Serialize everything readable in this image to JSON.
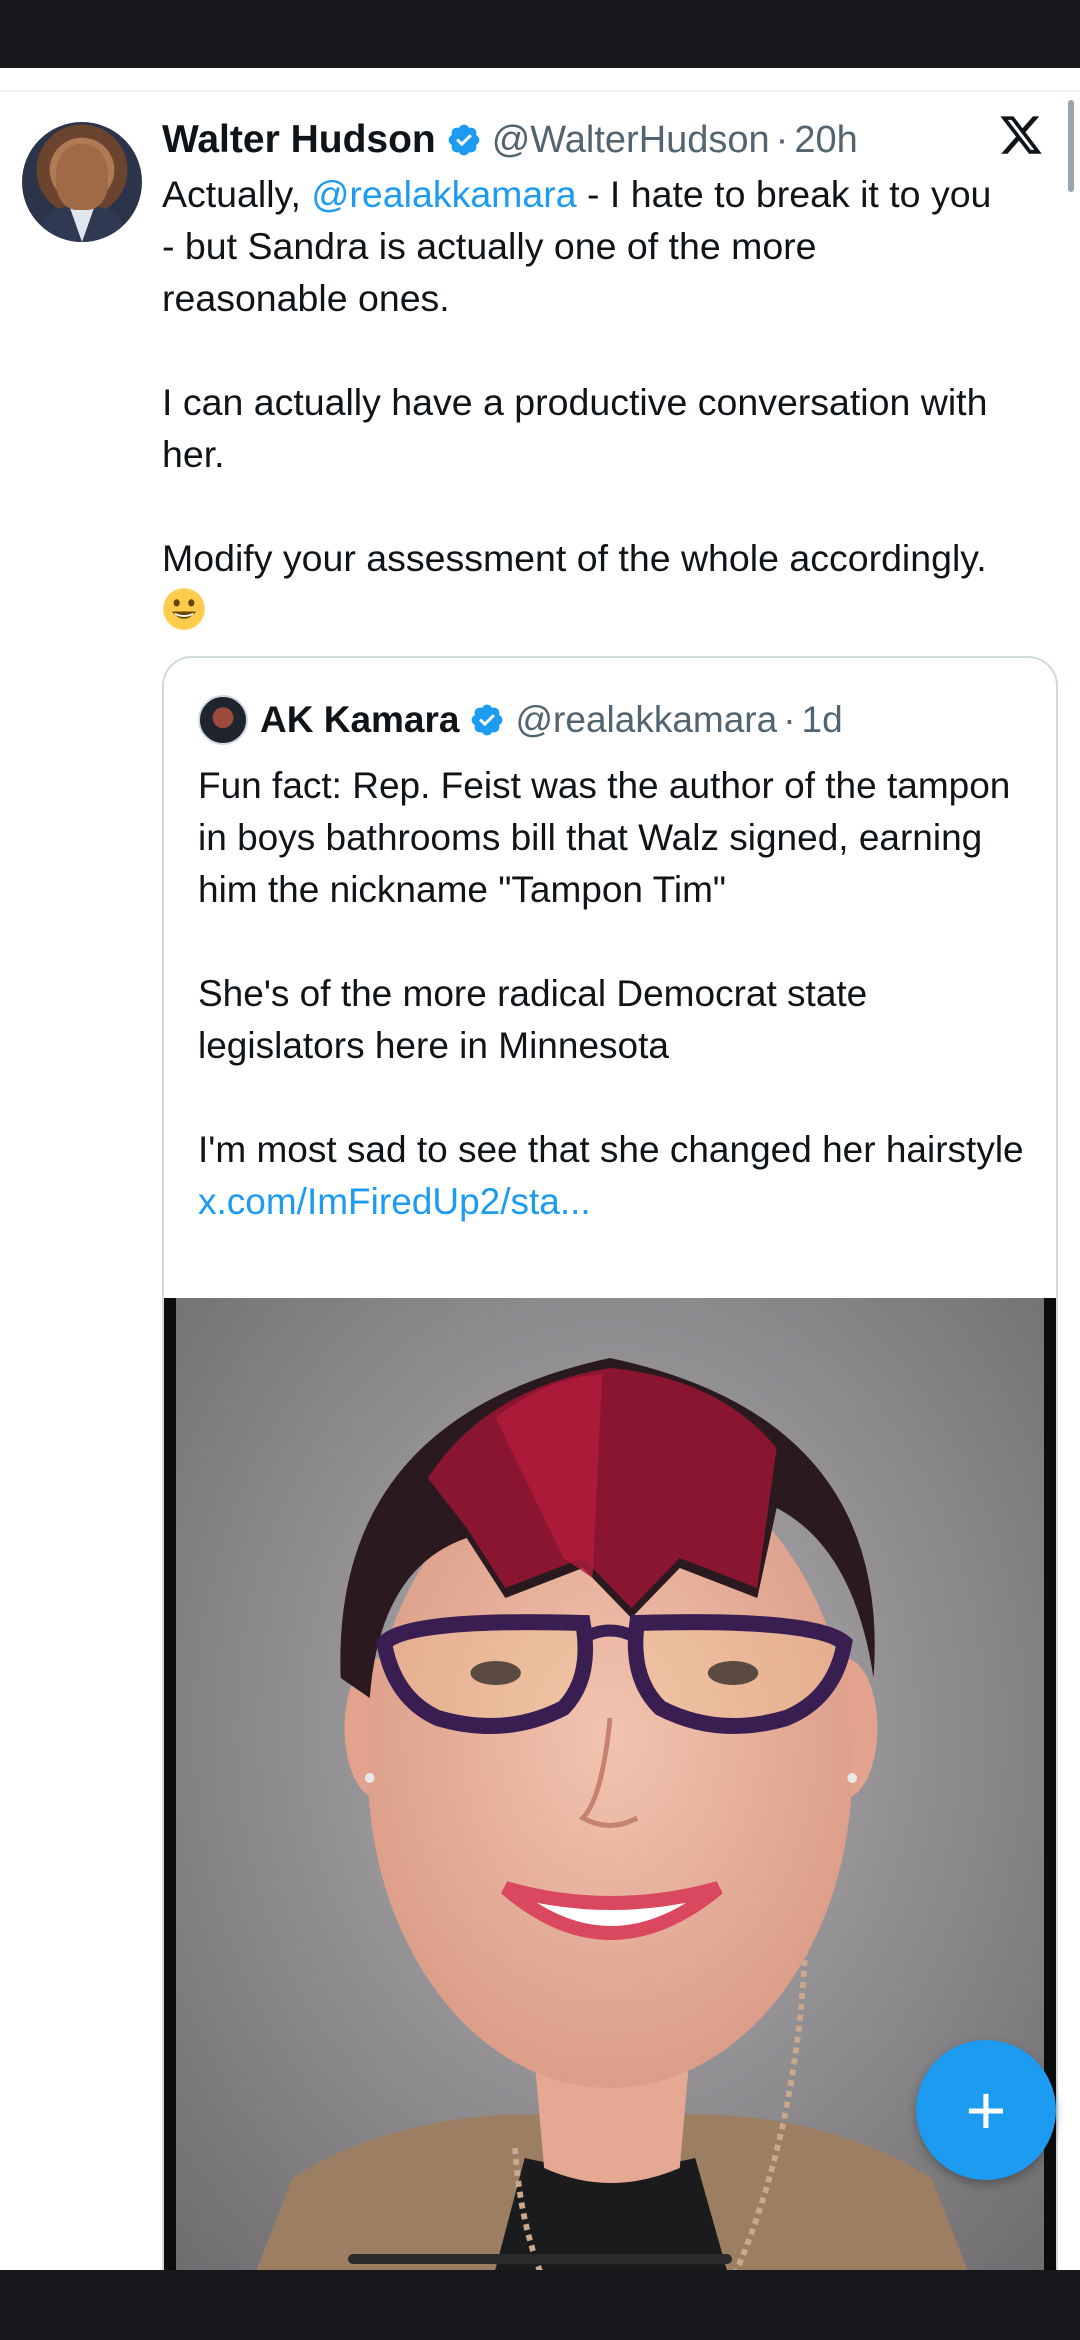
{
  "tweet": {
    "author_name": "Walter Hudson",
    "author_handle": "@WalterHudson",
    "separator": "·",
    "time": "20h",
    "text_part1": "Actually, ",
    "mention": "@realakkamara",
    "text_part2": " - I hate to break it to you - but Sandra is actually one of the more reasonable ones.",
    "paragraph2": "I can actually have a productive conversation with her.",
    "paragraph3": "Modify your assessment of the whole accordingly.",
    "emoji": "grinning-face-emoji"
  },
  "quote": {
    "author_name": "AK Kamara",
    "author_handle": "@realakkamara",
    "separator": "·",
    "time": "1d",
    "paragraph1": "Fun fact: Rep. Feist was the author of the tampon in boys bathrooms bill that Walz signed, earning him the nickname \"Tampon Tim\"",
    "paragraph2": "She's of the more radical Democrat state legislators here in Minnesota",
    "paragraph3_text": "I'm most sad to see that she changed her hairstyle ",
    "paragraph3_link": "x.com/ImFiredUp2/sta..."
  },
  "fab": {
    "label": "+"
  },
  "colors": {
    "accent": "#1d9bf0",
    "text": "#0f1419",
    "secondary": "#536471",
    "border": "#cfd9de",
    "system_bar": "#16181c"
  }
}
